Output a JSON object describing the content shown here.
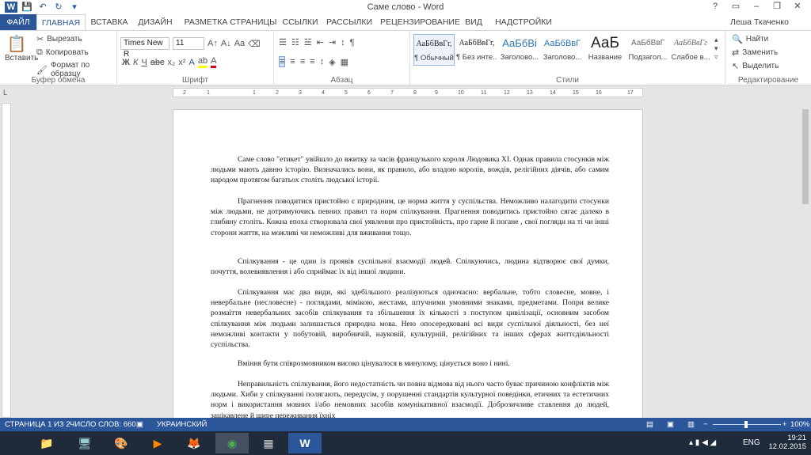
{
  "window": {
    "title": "Саме слово - Word",
    "controls": [
      "?",
      "▭",
      "–",
      "❐",
      "✕"
    ]
  },
  "qat": {
    "icons": [
      "word-logo-icon",
      "save-icon",
      "undo-icon",
      "redo-icon",
      "customize-icon"
    ]
  },
  "tabs": [
    {
      "label": "ФАЙЛ"
    },
    {
      "label": "ГЛАВНАЯ"
    },
    {
      "label": "ВСТАВКА"
    },
    {
      "label": "ДИЗАЙН"
    },
    {
      "label": "РАЗМЕТКА СТРАНИЦЫ"
    },
    {
      "label": "ССЫЛКИ"
    },
    {
      "label": "РАССЫЛКИ"
    },
    {
      "label": "РЕЦЕНЗИРОВАНИЕ"
    },
    {
      "label": "ВИД"
    },
    {
      "label": "НАДСТРОЙКИ"
    }
  ],
  "user": "Леша Ткаченко",
  "clipboard": {
    "paste": "Вставить",
    "cut": "Вырезать",
    "copy": "Копировать",
    "format_painter": "Формат по образцу",
    "label": "Буфер обмена"
  },
  "font": {
    "name": "Times New R",
    "size": "11",
    "label": "Шрифт",
    "buttons": [
      "Ж",
      "К",
      "Ч",
      "abc",
      "x₂",
      "x²"
    ]
  },
  "paragraph": {
    "label": "Абзац"
  },
  "styles": {
    "label": "Стили",
    "items": [
      {
        "preview": "АаБбВвГг,",
        "name": "¶ Обычный"
      },
      {
        "preview": "АаБбВвГг,",
        "name": "¶ Без инте..."
      },
      {
        "preview": "АаБбВі",
        "name": "Заголово..."
      },
      {
        "preview": "АаБбВвГ",
        "name": "Заголово..."
      },
      {
        "preview": "АаБ",
        "name": "Название"
      },
      {
        "preview": "АаБбВвГ",
        "name": "Подзагол..."
      },
      {
        "preview": "АаБбВвГг",
        "name": "Слабое в..."
      }
    ]
  },
  "editing": {
    "find": "Найти",
    "replace": "Заменить",
    "select": "Выделить",
    "label": "Редактирование"
  },
  "ruler": [
    "2",
    "1",
    "1",
    "2",
    "3",
    "4",
    "5",
    "6",
    "7",
    "8",
    "9",
    "10",
    "11",
    "12",
    "13",
    "14",
    "15",
    "16",
    "17",
    "18"
  ],
  "document": {
    "paragraphs": [
      "Саме слово \"етикет\" увійшло до вжитку за часів французького короля Людовика XI. Однак правила стосунків між людьми мають давню історію. Визначались вони, як правило, або владою королів, вождів, релігійних діячів, або самим народом протягом багатьох століть людської історії.",
      "Прагнення поводитися пристойно є природним, це норма життя у суспільства. Неможливо налагодити стосунки між людьми, не дотримуючись певних правил та норм спілкування. Прагнення поводитись пристойно сягає далеко в глибину століть. Кожна епоха створювала свої уявлення про пристойність, про гарне й погане , свої погляди на ті чи інші сторони життя, на можливі чи неможливі для вживання тощо.",
      "Спілкування - це один із проявів суспільної взаємодії людей. Спілкуючись, людина відтворює свої думки, почуття, волевиявлення і або сприймає їх від іншої людини.",
      "Спілкування має два види, які здебільшого реалізуються одночасно: вербальне, тобто словесне, мовне, і невербальне (несловесне) - поглядами, мімікою, жестами, штучними умовними знаками, предметами. Попри велике розмаїття невербальних засобів спілкування та збільшення їх кількості з поступом цивілізації, основним засобом спілкування між людьми залишається природна мова. Нею опосередковані всі види суспільної діяльності, без неї неможливі контакти у побутовій, виробничій, науковій, культурній, релігійних та інших сферах життєдіяльності суспільства.",
      "Вміння бути співрозмовником високо цінувалося в минулому, цінується воно і нині.",
      "Неправильність спілкування, його недостатність чи повна відмова від нього часто буває причиною конфліктів між людьми. Хиби у спілкуванні полягають, передусім, у порушенні стандартів культурної поведінки, етичних та естетичних норм і використання мовних і/або немовних засобів комунікативної взаємодії. Доброзичливе ставлення до людей, зацікавлене й щире переживання їхніх"
    ]
  },
  "status": {
    "page": "СТРАНИЦА 1 ИЗ 2",
    "words": "ЧИСЛО СЛОВ: 660",
    "language": "УКРАИНСКИЙ",
    "zoom": "100%"
  },
  "taskbar": {
    "apps": [
      "explorer-icon",
      "computer-icon",
      "paint-icon",
      "media-icon",
      "firefox-icon",
      "chrome-icon",
      "calculator-icon",
      "word-icon"
    ],
    "lang": "ENG",
    "time": "19:21",
    "date": "12.02.2015"
  }
}
